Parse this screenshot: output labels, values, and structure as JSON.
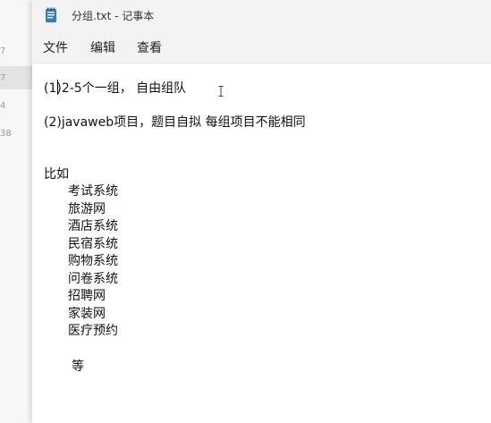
{
  "background_app": {
    "numbers": [
      "7",
      "7",
      "4",
      "38"
    ]
  },
  "window": {
    "title": "分组.txt - 记事本"
  },
  "menu": {
    "file": "文件",
    "edit": "编辑",
    "view": "查看"
  },
  "document": {
    "line1": "(1)2-5个一组， 自由组队",
    "line2": "(2)javaweb项目，题目自拟 每组项目不能相同",
    "examples_label": "比如",
    "examples": [
      "考试系统",
      "旅游网",
      "酒店系统",
      "民宿系统",
      "购物系统",
      "问卷系统",
      "招聘网",
      "家装网",
      "医疗预约"
    ],
    "etc": "等"
  },
  "colors": {
    "menu_bg": "#f3f3f3",
    "editor_bg": "#ffffff",
    "icon_blue": "#3a78c4"
  }
}
